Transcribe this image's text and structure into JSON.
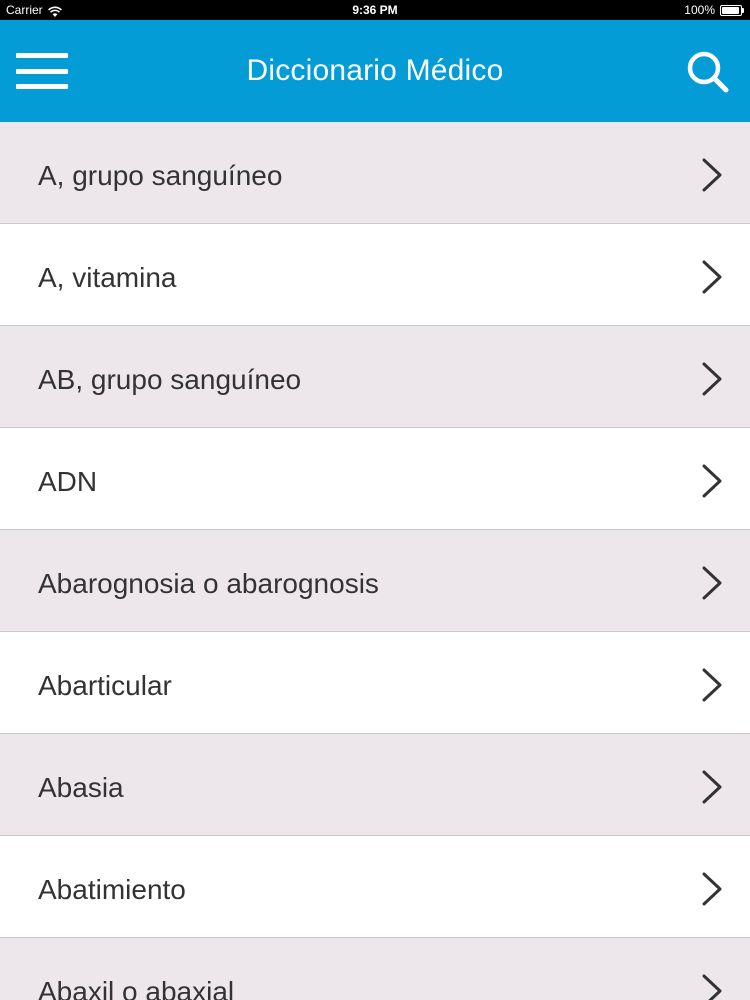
{
  "status_bar": {
    "carrier": "Carrier",
    "time": "9:36 PM",
    "battery": "100%",
    "wifi_icon": "wifi-icon",
    "battery_icon": "battery-icon"
  },
  "nav_bar": {
    "title": "Diccionario Médico",
    "menu_icon": "hamburger-menu-icon",
    "search_icon": "search-icon",
    "color": "#039cd7"
  },
  "list": {
    "items": [
      {
        "label": "A, grupo sanguíneo"
      },
      {
        "label": "A, vitamina"
      },
      {
        "label": "AB, grupo sanguíneo"
      },
      {
        "label": "ADN"
      },
      {
        "label": "Abarognosia o abarognosis"
      },
      {
        "label": "Abarticular"
      },
      {
        "label": "Abasia"
      },
      {
        "label": "Abatimiento"
      },
      {
        "label": "Abaxil o abaxial"
      }
    ],
    "row_colors": [
      "#ede7ec",
      "#ffffff"
    ],
    "chevron_icon": "chevron-right-icon"
  }
}
